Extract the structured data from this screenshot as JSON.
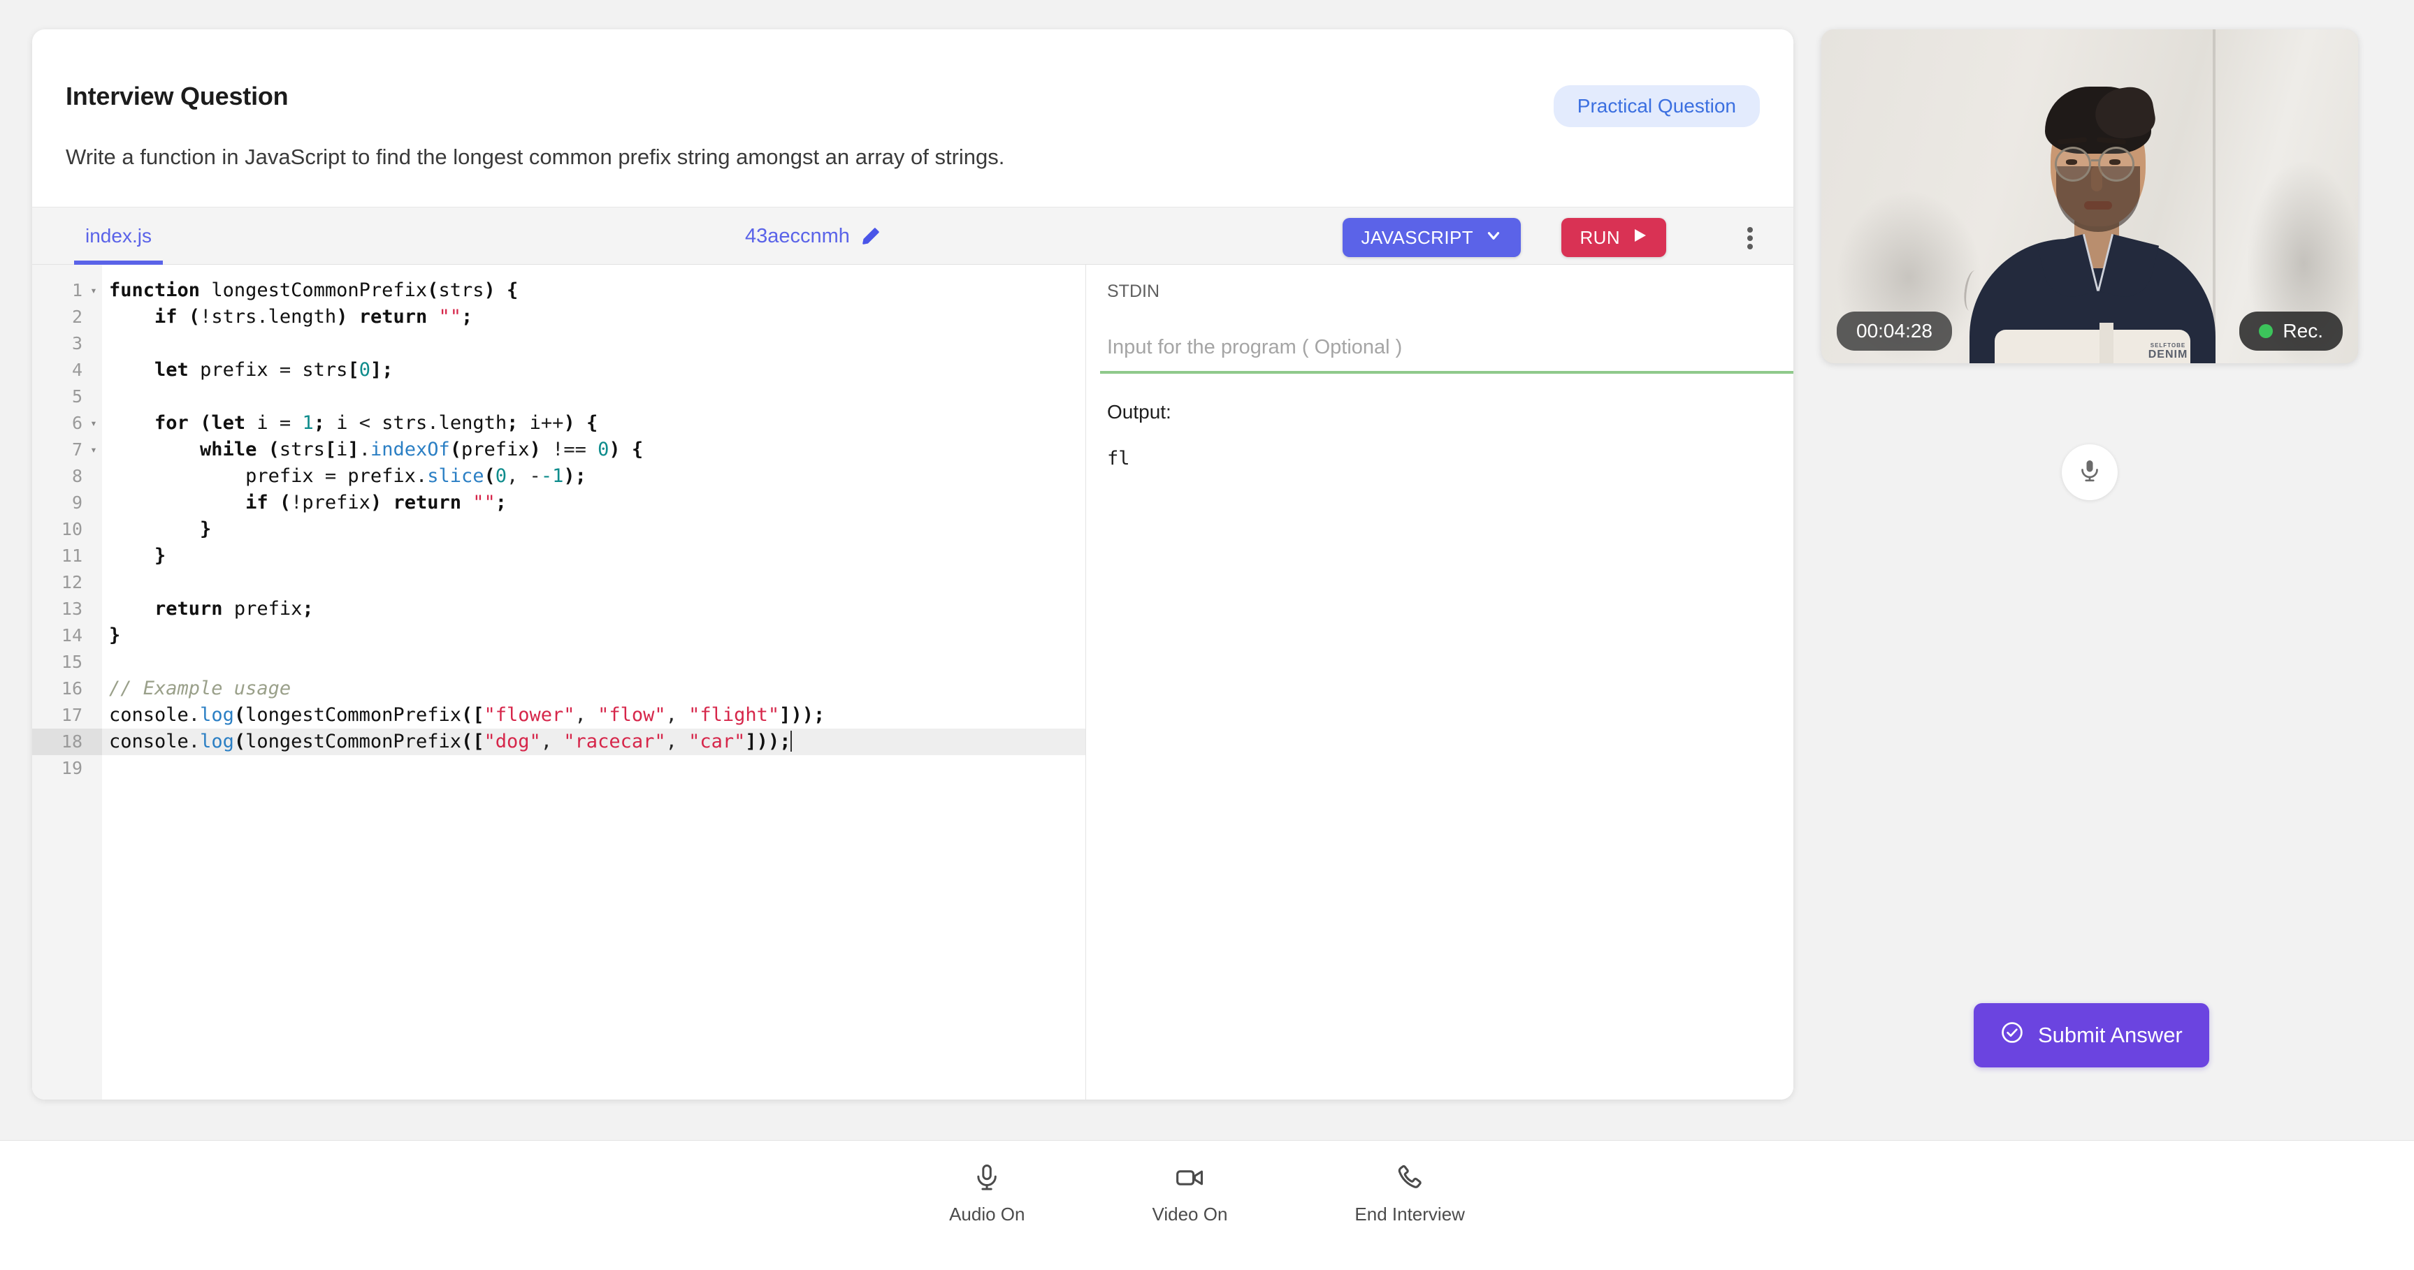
{
  "question": {
    "title": "Interview Question",
    "text": "Write a function in JavaScript to find the longest common prefix string amongst an array of strings.",
    "badge": "Practical Question"
  },
  "editor": {
    "file_tab": "index.js",
    "project_name": "43aeccnmh",
    "edit_icon": "pencil-icon",
    "language_button": "JAVASCRIPT",
    "language_caret_icon": "chevron-down-icon",
    "run_button": "RUN",
    "run_icon": "play-icon",
    "kebab_icon": "more-vertical-icon",
    "lines": [
      {
        "num": "1",
        "fold": true,
        "active": false
      },
      {
        "num": "2",
        "fold": false,
        "active": false
      },
      {
        "num": "3",
        "fold": false,
        "active": false
      },
      {
        "num": "4",
        "fold": false,
        "active": false
      },
      {
        "num": "5",
        "fold": false,
        "active": false
      },
      {
        "num": "6",
        "fold": true,
        "active": false
      },
      {
        "num": "7",
        "fold": true,
        "active": false
      },
      {
        "num": "8",
        "fold": false,
        "active": false
      },
      {
        "num": "9",
        "fold": false,
        "active": false
      },
      {
        "num": "10",
        "fold": false,
        "active": false
      },
      {
        "num": "11",
        "fold": false,
        "active": false
      },
      {
        "num": "12",
        "fold": false,
        "active": false
      },
      {
        "num": "13",
        "fold": false,
        "active": false
      },
      {
        "num": "14",
        "fold": false,
        "active": false
      },
      {
        "num": "15",
        "fold": false,
        "active": false
      },
      {
        "num": "16",
        "fold": false,
        "active": false
      },
      {
        "num": "17",
        "fold": false,
        "active": false
      },
      {
        "num": "18",
        "fold": false,
        "active": true
      },
      {
        "num": "19",
        "fold": false,
        "active": false
      }
    ],
    "code_text": [
      "function longestCommonPrefix(strs) {",
      "    if (!strs.length) return \"\";",
      "",
      "    let prefix = strs[0];",
      "",
      "    for (let i = 1; i < strs.length; i++) {",
      "        while (strs[i].indexOf(prefix) !== 0) {",
      "            prefix = prefix.slice(0, -1);",
      "            if (!prefix) return \"\";",
      "        }",
      "    }",
      "",
      "    return prefix;",
      "}",
      "",
      "// Example usage",
      "console.log(longestCommonPrefix([\"flower\", \"flow\", \"flight\"]));",
      "console.log(longestCommonPrefix([\"dog\", \"racecar\", \"car\"]));",
      ""
    ]
  },
  "io": {
    "stdin_label": "STDIN",
    "stdin_value": "",
    "stdin_placeholder": "Input for the program ( Optional )",
    "output_label": "Output:",
    "output_value": "fl"
  },
  "video": {
    "timer": "00:04:28",
    "recording_label": "Rec.",
    "recording_dot_color": "#3cc45b",
    "mic_icon": "microphone-icon",
    "shirt_brand": "DENIM",
    "shirt_brand_small": "SELFTOBE"
  },
  "actions": {
    "submit_label": "Submit Answer",
    "submit_icon": "check-circle-icon"
  },
  "footer": {
    "controls": [
      {
        "label": "Audio On",
        "icon": "microphone-icon"
      },
      {
        "label": "Video On",
        "icon": "video-camera-icon"
      },
      {
        "label": "End Interview",
        "icon": "phone-icon"
      }
    ]
  },
  "colors": {
    "accent_blue": "#5b63e8",
    "run_red": "#d93254",
    "submit_purple": "#6b44e0",
    "badge_bg": "#e3ebfd",
    "badge_text": "#3b6fe0",
    "stdin_underline": "#8fc98b"
  }
}
